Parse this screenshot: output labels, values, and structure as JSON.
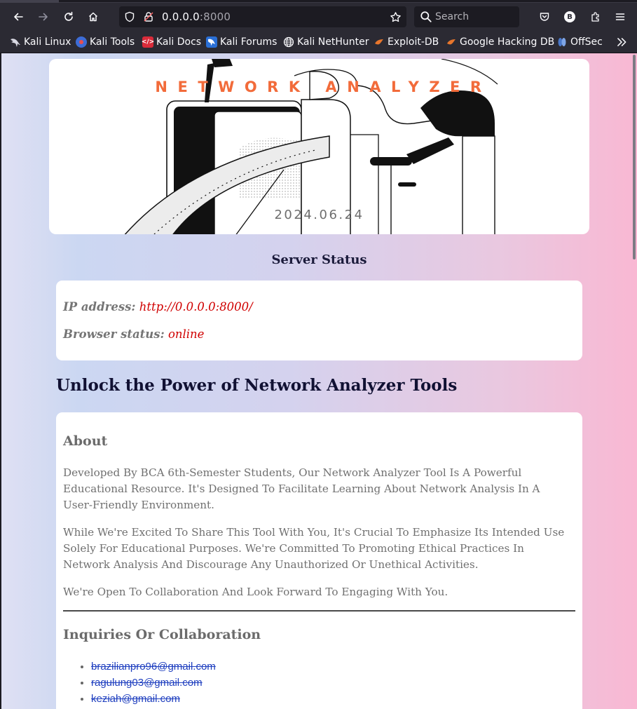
{
  "browser": {
    "url_host": "0.0.0.0",
    "url_port": ":8000",
    "search_placeholder": "Search",
    "profile_initial": "B",
    "bookmarks": [
      {
        "label": "Kali Linux",
        "icon": "kali-dragon-icon"
      },
      {
        "label": "Kali Tools",
        "icon": "kali-tools-icon"
      },
      {
        "label": "Kali Docs",
        "icon": "kali-docs-icon"
      },
      {
        "label": "Kali Forums",
        "icon": "kali-forums-icon"
      },
      {
        "label": "Kali NetHunter",
        "icon": "globe-icon"
      },
      {
        "label": "Exploit-DB",
        "icon": "exploit-db-icon"
      },
      {
        "label": "Google Hacking DB",
        "icon": "ghdb-icon"
      },
      {
        "label": "OffSec",
        "icon": "offsec-icon"
      }
    ]
  },
  "banner": {
    "title": "NETWORK ANALYZER",
    "date": "2024.06.24"
  },
  "server_status": {
    "heading": "Server Status",
    "ip_label": "IP address:",
    "ip_value": "http://0.0.0.0:8000/",
    "browser_label": "Browser status:",
    "browser_value": "online"
  },
  "main": {
    "heading": "Unlock the Power of Network Analyzer Tools",
    "about_title": "About",
    "paragraphs": [
      "Developed By BCA 6th-Semester Students, Our Network Analyzer Tool Is A Powerful Educational Resource. It's Designed To Facilitate Learning About Network Analysis In A User-Friendly Environment.",
      "While We're Excited To Share This Tool With You, It's Crucial To Emphasize Its Intended Use Solely For Educational Purposes. We're Committed To Promoting Ethical Practices In Network Analysis And Discourage Any Unauthorized Or Unethical Activities.",
      "We're Open To Collaboration And Look Forward To Engaging With You."
    ],
    "inquiries_title": "Inquiries Or Collaboration",
    "emails": [
      "brazilianpro96@gmail.com",
      "ragulung03@gmail.com",
      "keziah@gmail.com"
    ]
  },
  "colors": {
    "accent_title": "#f26b3a",
    "status_value": "#d00000",
    "link": "#1f3fbf"
  }
}
